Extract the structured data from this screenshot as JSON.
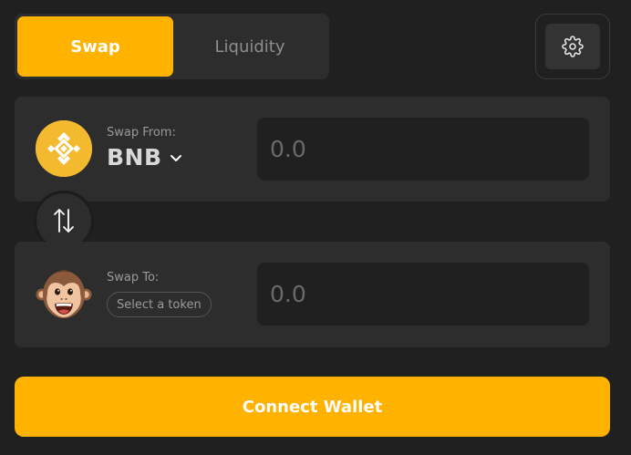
{
  "tabs": {
    "swap_label": "Swap",
    "liquidity_label": "Liquidity",
    "active": "Swap"
  },
  "settings": {
    "icon": "gear-icon"
  },
  "from": {
    "label": "Swap From:",
    "token": "BNB",
    "token_icon": "bnb-logo",
    "amount_placeholder": "0.0"
  },
  "switch": {
    "icon": "swap-arrows-icon"
  },
  "to": {
    "label": "Swap To:",
    "select_label": "Select a token",
    "token_icon": "monkey-face-icon",
    "amount_placeholder": "0.0"
  },
  "connect": {
    "label": "Connect Wallet"
  },
  "colors": {
    "accent": "#ffb300",
    "background": "#202020",
    "card": "#2d2d2d",
    "bnb": "#f3ba2f"
  }
}
